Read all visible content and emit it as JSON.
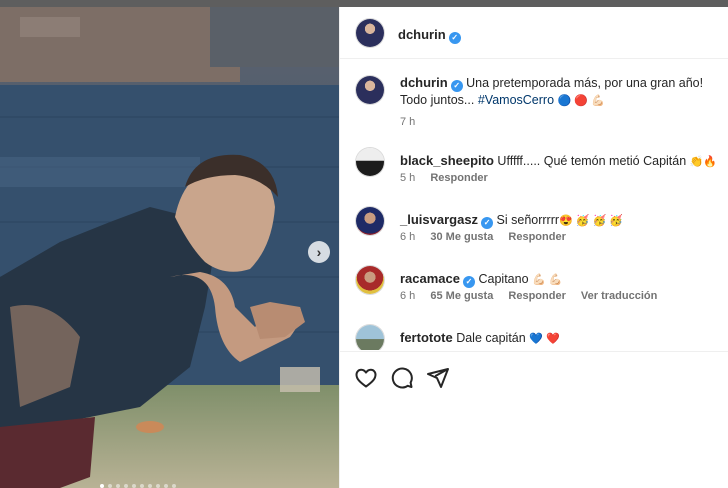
{
  "post": {
    "username": "dchurin",
    "verified_mark": "✓",
    "caption": {
      "username": "dchurin",
      "text": "Una pretemporada más, por una gran año! Todo juntos...",
      "hashtag": "#VamosCerro",
      "emojis": "🔵 🔴 💪🏻",
      "time": "7 h"
    },
    "comments": [
      {
        "username": "black_sheepito",
        "verified": false,
        "text": "Ufffff..... Qué temón metió Capitán",
        "emojis": "👏🔥",
        "time": "5 h",
        "likes": "",
        "reply": "Responder",
        "translate": ""
      },
      {
        "username": "_luisvargasz",
        "verified": true,
        "text": "Si señorrrrr",
        "emojis": "😍 🥳 🥳 🥳",
        "time": "6 h",
        "likes": "30 Me gusta",
        "reply": "Responder",
        "translate": ""
      },
      {
        "username": "racamace",
        "verified": true,
        "text": "Capitano",
        "emojis": "💪🏻 💪🏻",
        "time": "6 h",
        "likes": "65 Me gusta",
        "reply": "Responder",
        "translate": "Ver traducción"
      },
      {
        "username": "fertotote",
        "verified": false,
        "text": "Dale capitán",
        "emojis": "💙 ❤️",
        "time": "",
        "likes": "",
        "reply": "",
        "translate": ""
      }
    ],
    "actions": {
      "like_icon": "heart-icon",
      "comment_icon": "comment-icon",
      "share_icon": "share-icon"
    },
    "carousel": {
      "next_glyph": "›",
      "slides": 10,
      "active": 1
    }
  },
  "colors": {
    "link": "#00376b",
    "verified": "#3897f0",
    "meta": "#737373"
  }
}
